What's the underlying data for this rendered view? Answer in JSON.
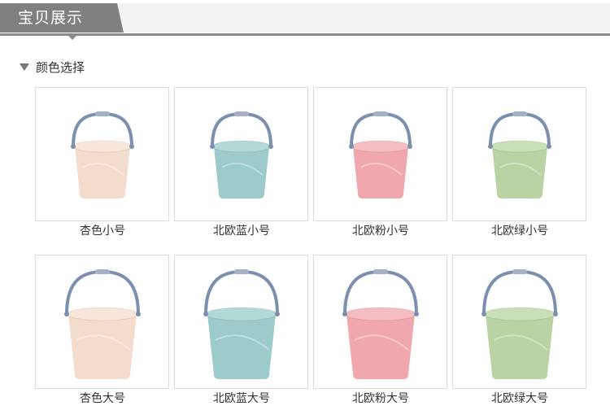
{
  "header": {
    "title": "宝贝展示"
  },
  "section": {
    "title": "颜色选择"
  },
  "products": [
    {
      "label": "杏色小号",
      "color": "#f4dccd",
      "rim": "#f8e6da",
      "size": "small"
    },
    {
      "label": "北欧蓝小号",
      "color": "#9dcacb",
      "rim": "#b3d8d8",
      "size": "small"
    },
    {
      "label": "北欧粉小号",
      "color": "#f0a7ad",
      "rim": "#f5bcc1",
      "size": "small"
    },
    {
      "label": "北欧绿小号",
      "color": "#b9d3a4",
      "rim": "#c9dfb7",
      "size": "small"
    },
    {
      "label": "杏色大号",
      "color": "#f4dccd",
      "rim": "#f8e6da",
      "size": "large"
    },
    {
      "label": "北欧蓝大号",
      "color": "#9dcacb",
      "rim": "#b3d8d8",
      "size": "large"
    },
    {
      "label": "北欧粉大号",
      "color": "#f0a7ad",
      "rim": "#f5bcc1",
      "size": "large"
    },
    {
      "label": "北欧绿大号",
      "color": "#b9d3a4",
      "rim": "#c9dfb7",
      "size": "large"
    }
  ],
  "colors": {
    "header_tab": "#808080",
    "header_strip": "#f2f2f2",
    "handle": "#7b8fae",
    "border": "#dcdcdc"
  }
}
